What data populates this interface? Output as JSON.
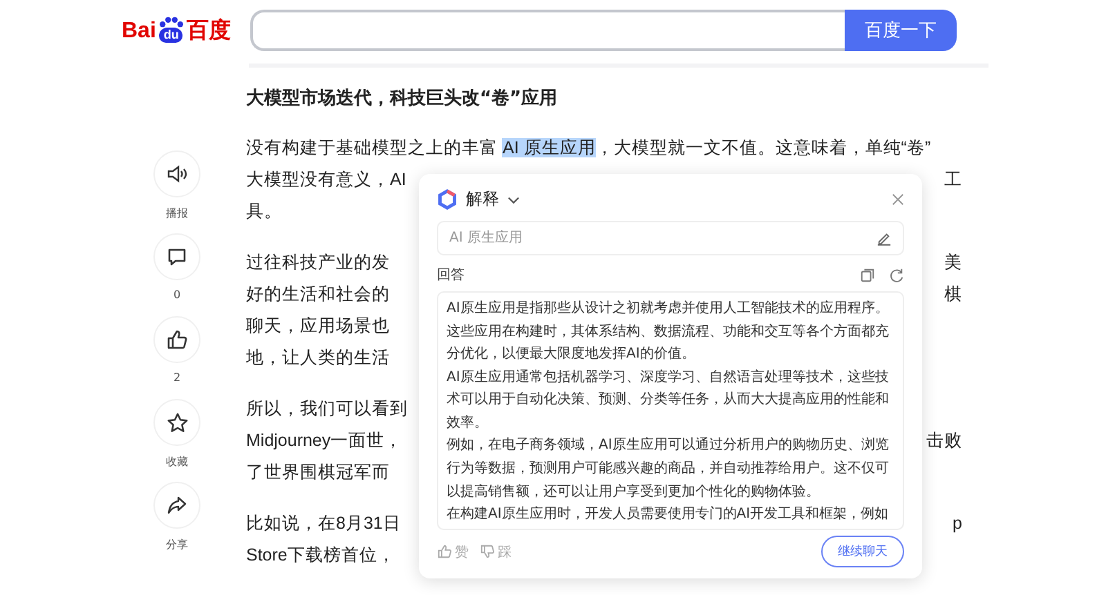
{
  "header": {
    "logo": {
      "left": "Bai",
      "paw": "du",
      "right": "百度"
    },
    "search_button": "百度一下"
  },
  "actions": [
    {
      "kind": "speaker",
      "label": "播报"
    },
    {
      "kind": "comment",
      "label": "0"
    },
    {
      "kind": "like",
      "label": "2"
    },
    {
      "kind": "star",
      "label": "收藏"
    },
    {
      "kind": "share",
      "label": "分享"
    }
  ],
  "article": {
    "title": "大模型市场迭代，科技巨头改“卷”应用",
    "paragraphs": [
      {
        "lines": [
          {
            "segments": [
              {
                "text": "没有构建于基础模型之上的丰富 ",
                "highlighted": false
              },
              {
                "text": "AI 原生应用",
                "highlighted": true
              },
              {
                "text": "，大模型就一文不值。这意味着，单纯“卷”",
                "highlighted": false
              }
            ]
          },
          {
            "segments": [
              {
                "text": "大模型没有意义，AI",
                "highlighted": false
              }
            ],
            "right": "工"
          },
          {
            "segments": [
              {
                "text": "具。",
                "highlighted": false
              }
            ]
          }
        ]
      },
      {
        "lines": [
          {
            "segments": [
              {
                "text": "过往科技产业的发",
                "highlighted": false
              }
            ],
            "right": "美"
          },
          {
            "segments": [
              {
                "text": "好的生活和社会的",
                "highlighted": false
              }
            ],
            "right": "棋"
          },
          {
            "segments": [
              {
                "text": "聊天，应用场景也",
                "highlighted": false
              }
            ]
          },
          {
            "segments": [
              {
                "text": "地，让人类的生活",
                "highlighted": false
              }
            ]
          }
        ]
      },
      {
        "lines": [
          {
            "segments": [
              {
                "text": "所以，我们可以看到",
                "highlighted": false
              }
            ]
          },
          {
            "segments": [
              {
                "text": "Midjourney一面世，",
                "highlighted": false
              }
            ],
            "right": "击败"
          },
          {
            "segments": [
              {
                "text": "了世界围棋冠军而",
                "highlighted": false
              }
            ]
          }
        ]
      },
      {
        "lines": [
          {
            "segments": [
              {
                "text": "比如说，在8月31日",
                "highlighted": false
              }
            ],
            "right": "p"
          },
          {
            "segments": [
              {
                "text": "Store下载榜首位，",
                "highlighted": false
              }
            ]
          }
        ]
      }
    ]
  },
  "popup": {
    "title": "解释",
    "query": "AI 原生应用",
    "answer_label": "回答",
    "answer": [
      "AI原生应用是指那些从设计之初就考虑并使用人工智能技术的应用程序。这些应用在构建时，其体系结构、数据流程、功能和交互等各个方面都充分优化，以便最大限度地发挥AI的价值。",
      "AI原生应用通常包括机器学习、深度学习、自然语言处理等技术，这些技术可以用于自动化决策、预测、分类等任务，从而大大提高应用的性能和效率。",
      "例如，在电子商务领域，AI原生应用可以通过分析用户的购物历史、浏览行为等数据，预测用户可能感兴趣的商品，并自动推荐给用户。这不仅可以提高销售额，还可以让用户享受到更加个性化的购物体验。",
      "在构建AI原生应用时，开发人员需要使用专门的AI开发工具和框架，例如"
    ],
    "feedback": [
      {
        "kind": "like",
        "label": "赞"
      },
      {
        "kind": "dislike",
        "label": "踩"
      }
    ],
    "continue_button": "继续聊天"
  }
}
